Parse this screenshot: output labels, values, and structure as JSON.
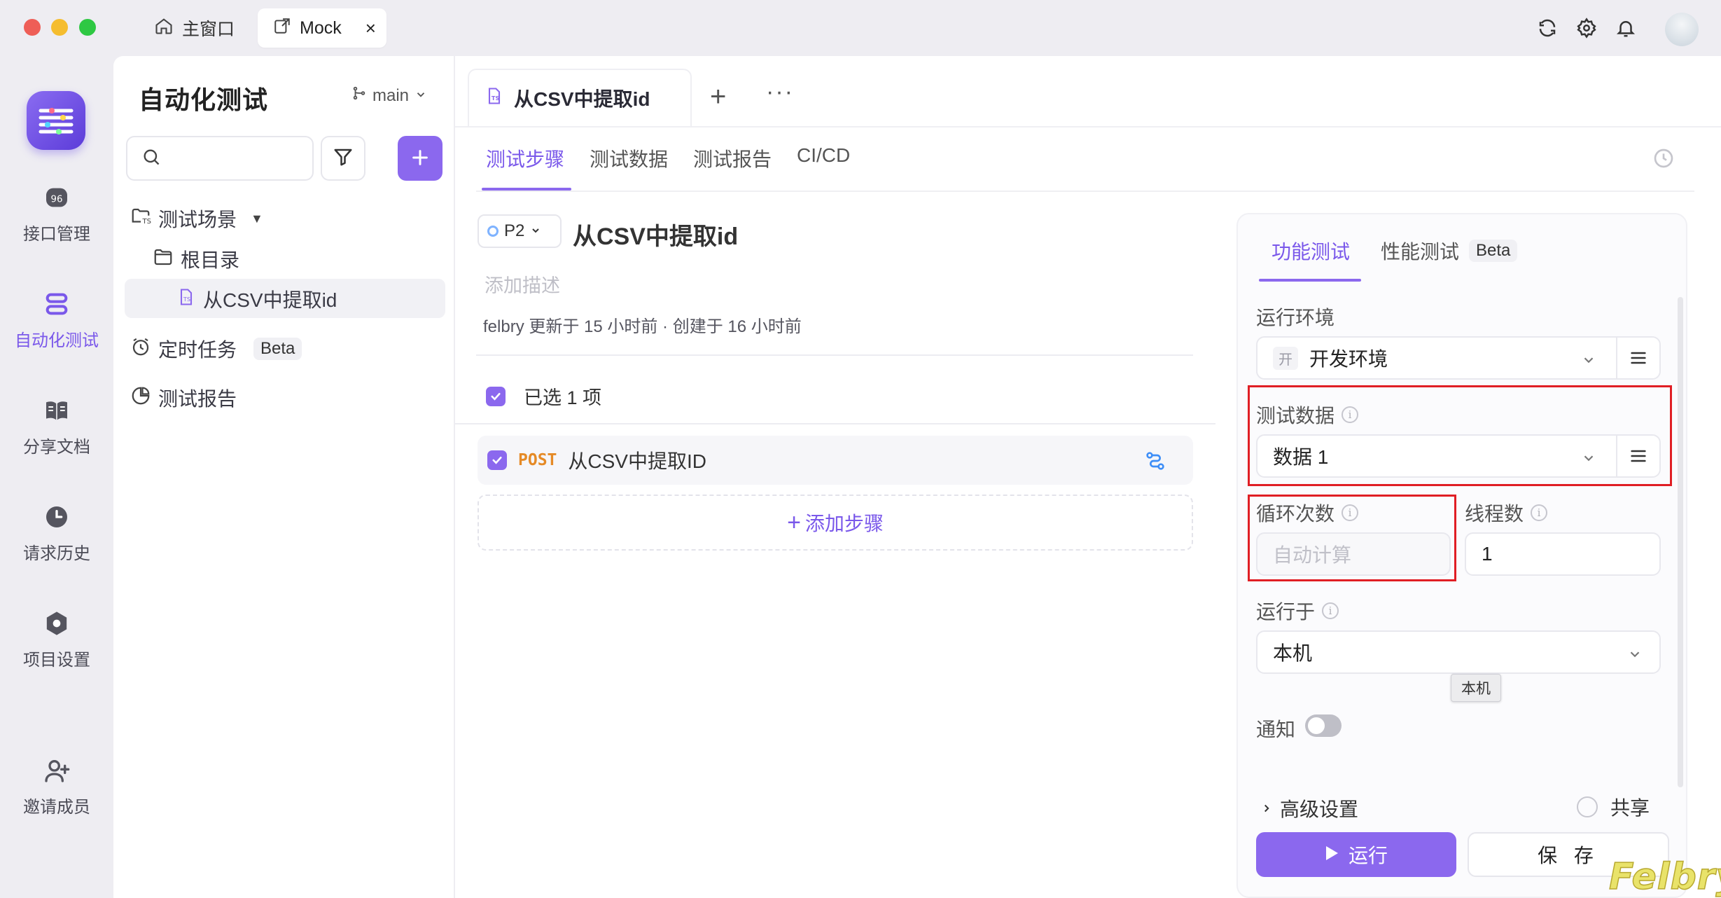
{
  "window": {
    "tabs": [
      {
        "label": "主窗口",
        "icon": "home-icon"
      },
      {
        "label": "Mock",
        "icon": "external-link-icon"
      }
    ],
    "close_symbol": "×"
  },
  "rail": {
    "items": [
      {
        "label": "接口管理",
        "icon": "api-icon"
      },
      {
        "label": "自动化测试",
        "icon": "automation-icon",
        "active": true
      },
      {
        "label": "分享文档",
        "icon": "book-icon"
      },
      {
        "label": "请求历史",
        "icon": "clock-icon"
      },
      {
        "label": "项目设置",
        "icon": "settings-hex-icon"
      },
      {
        "label": "邀请成员",
        "icon": "add-user-icon"
      }
    ]
  },
  "sidebar": {
    "title": "自动化测试",
    "branch": "main",
    "search_placeholder": "",
    "tree": {
      "scenes_label": "测试场景",
      "root_label": "根目录",
      "scenario_label": "从CSV中提取id"
    },
    "scheduled_label": "定时任务",
    "scheduled_badge": "Beta",
    "reports_label": "测试报告"
  },
  "main": {
    "doc_tab_label": "从CSV中提取id",
    "plus": "+",
    "more": "···",
    "sub_tabs": [
      "测试步骤",
      "测试数据",
      "测试报告",
      "CI/CD"
    ],
    "priority": "P2",
    "scenario_title": "从CSV中提取id",
    "description_placeholder": "添加描述",
    "meta_user": "felbry",
    "meta_rest": "更新于 15 小时前 · 创建于 16 小时前",
    "selected_text": "已选 1 项",
    "steps": [
      {
        "method": "POST",
        "name": "从CSV中提取ID"
      }
    ],
    "add_step_label": "添加步骤",
    "add_step_plus": "+"
  },
  "run_panel": {
    "tabs": {
      "functional": "功能测试",
      "performance": "性能测试",
      "performance_badge": "Beta"
    },
    "env_label": "运行环境",
    "env_tag": "开",
    "env_value": "开发环境",
    "test_data_label": "测试数据",
    "test_data_value": "数据 1",
    "loop_label": "循环次数",
    "loop_placeholder": "自动计算",
    "threads_label": "线程数",
    "threads_value": "1",
    "run_on_label": "运行于",
    "run_on_value": "本机",
    "tooltip": "本机",
    "notify_label": "通知",
    "notify_on": false,
    "advanced_label": "高级设置",
    "share_label": "共享",
    "run_button": "运行",
    "save_button": "保 存"
  },
  "watermark": "Felbry",
  "colors": {
    "accent": "#8b68ee",
    "highlight_box": "#e01e24",
    "post_method": "#e58a26"
  }
}
